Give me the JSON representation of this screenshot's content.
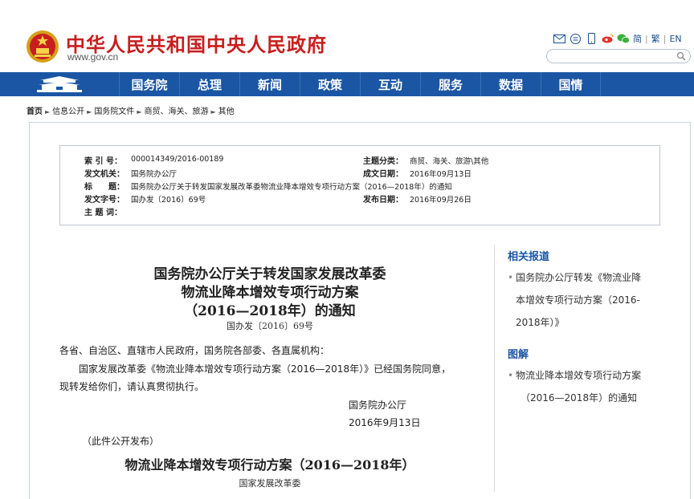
{
  "header": {
    "site_title": "中华人民共和国中央人民政府",
    "domain": "www.gov.cn",
    "lang_simplified": "简",
    "lang_traditional": "繁",
    "lang_en": "EN",
    "icons": [
      "mail-icon",
      "subscribe-icon",
      "mobile-icon",
      "weibo-icon",
      "wechat-icon"
    ],
    "accent_color": "#c81e1e"
  },
  "nav": {
    "bg_color": "#1a56a4",
    "items": [
      "国务院",
      "总理",
      "新闻",
      "政策",
      "互动",
      "服务",
      "数据",
      "国情"
    ]
  },
  "breadcrumb": {
    "home": "首页",
    "items": [
      "信息公开",
      "国务院文件",
      "商贸、海关、旅游",
      "其他"
    ]
  },
  "meta": {
    "index_label": "索 引 号：",
    "index_value": "000014349/2016-00189",
    "category_label": "主题分类：",
    "category_value": "商贸、海关、旅游\\其他",
    "issuer_label": "发文机关：",
    "issuer_value": "国务院办公厅",
    "created_label": "成文日期：",
    "created_value": "2016年09月13日",
    "title_label": "标　　题：",
    "title_value": "国务院办公厅关于转发国家发展改革委物流业降本增效专项行动方案（2016—2018年）的通知",
    "docno_label": "发文字号：",
    "docno_value": "国办发〔2016〕69号",
    "published_label": "发布日期：",
    "published_value": "2016年09月26日",
    "keywords_label": "主 题 词：",
    "keywords_value": ""
  },
  "article": {
    "title_line1": "国务院办公厅关于转发国家发展改革委",
    "title_line2": "物流业降本增效专项行动方案",
    "title_line3": "（2016—2018年）的通知",
    "docno": "国办发〔2016〕69号",
    "salutation": "各省、自治区、直辖市人民政府，国务院各部委、各直属机构：",
    "para1_line1": "国家发展改革委《物流业降本增效专项行动方案（2016—2018年）》已经国务院同意，",
    "para1_line2": "现转发给你们，请认真贯彻执行。",
    "sign_org": "国务院办公厅",
    "sign_date": "2016年9月13日",
    "note": "（此件公开发布）",
    "sub_title": "物流业降本增效专项行动方案（2016—2018年）",
    "sub_org": "国家发展改革委"
  },
  "sidebar": {
    "related_heading": "相关报道",
    "related_line1": "国务院办公厅转发《物流业降",
    "related_line2": "本增效专项行动方案（2016-",
    "related_line3": "2018年）》",
    "graphic_heading": "图解",
    "graphic_line1": "物流业降本增效专项行动方案",
    "graphic_line2": "（2016—2018年）的通知"
  }
}
